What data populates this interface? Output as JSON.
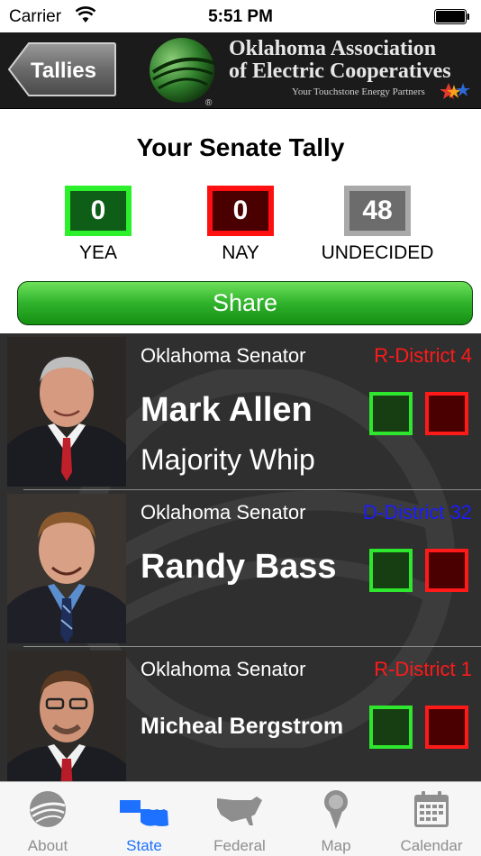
{
  "status_bar": {
    "carrier": "Carrier",
    "time": "5:51 PM"
  },
  "header": {
    "back_label": "Tallies",
    "org_name_line1": "Oklahoma Association",
    "org_name_line2": "of Electric Cooperatives",
    "tagline": "Your Touchstone Energy Partners"
  },
  "tally": {
    "title": "Your Senate Tally",
    "yea_count": "0",
    "yea_label": "YEA",
    "nay_count": "0",
    "nay_label": "NAY",
    "undecided_count": "48",
    "undecided_label": "UNDECIDED",
    "share_label": "Share"
  },
  "senators": [
    {
      "title": "Oklahoma Senator",
      "district": "R-District 4",
      "district_color": "#ff1a1a",
      "name": "Mark Allen",
      "role": "Majority Whip"
    },
    {
      "title": "Oklahoma Senator",
      "district": "D-District 32",
      "district_color": "#1c1cff",
      "name": "Randy Bass",
      "role": ""
    },
    {
      "title": "Oklahoma Senator",
      "district": "R-District 1",
      "district_color": "#ff1a1a",
      "name": "Micheal Bergstrom",
      "role": ""
    }
  ],
  "tabs": [
    {
      "label": "About",
      "icon": "about-globe-icon"
    },
    {
      "label": "State",
      "icon": "oklahoma-state-icon"
    },
    {
      "label": "Federal",
      "icon": "usa-map-icon"
    },
    {
      "label": "Map",
      "icon": "map-pin-icon"
    },
    {
      "label": "Calendar",
      "icon": "calendar-icon"
    }
  ],
  "active_tab": "State",
  "colors": {
    "accent": "#1e70ff",
    "yea": "#2ee62e",
    "nay": "#ff1a1a",
    "undecided": "#a9a9a9"
  }
}
